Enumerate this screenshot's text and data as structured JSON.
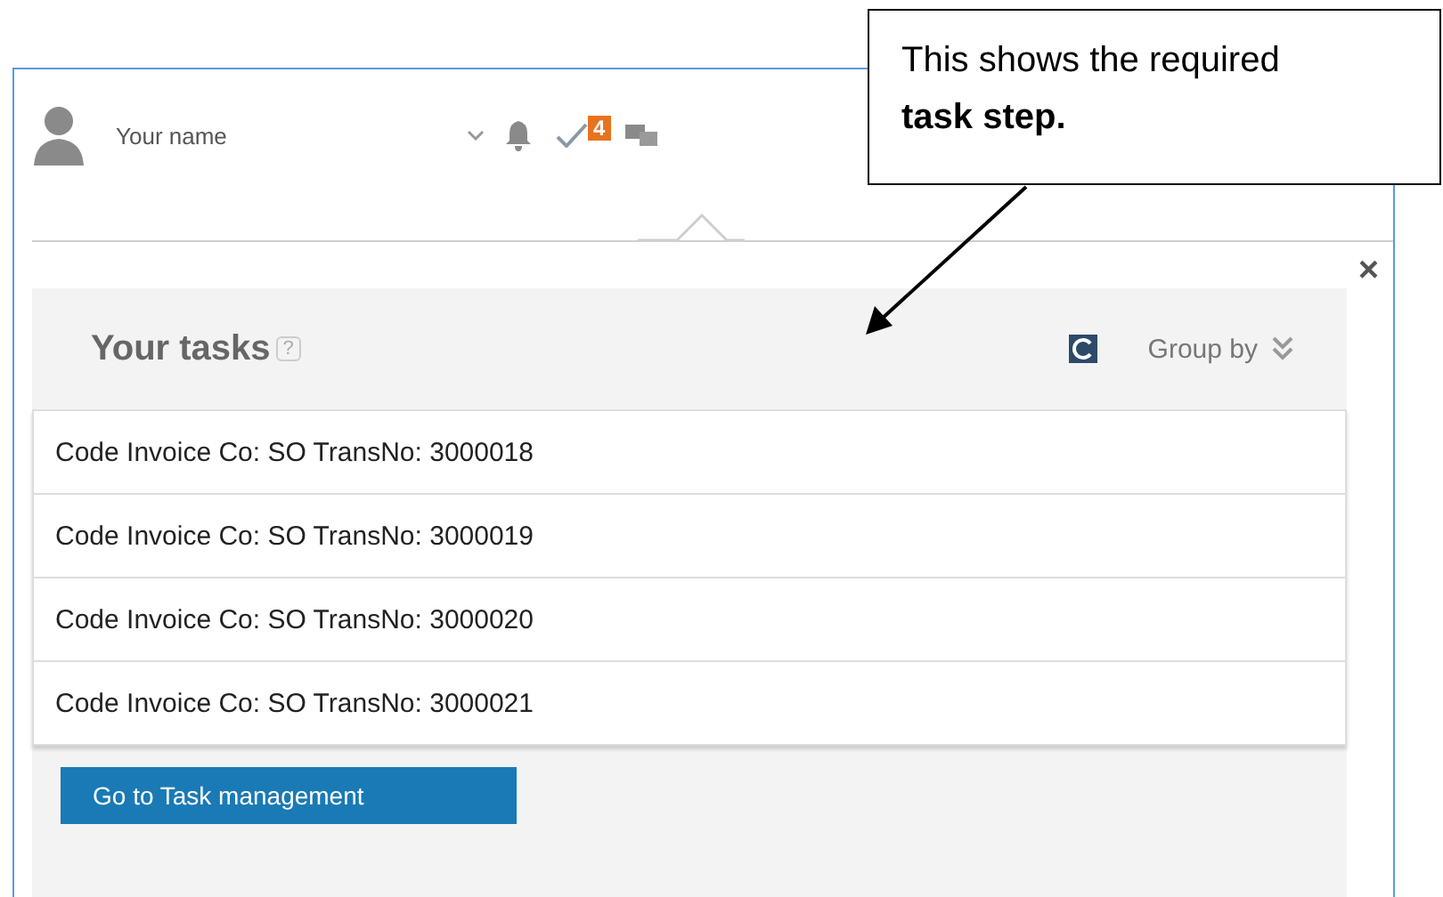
{
  "header": {
    "user_name": "Your name",
    "task_badge": "4"
  },
  "popup": {
    "close": "×",
    "title": "Your tasks",
    "help": "?",
    "group_by": "Group by",
    "tasks": [
      "Code Invoice Co: SO TransNo: 3000018",
      "Code Invoice Co: SO TransNo: 3000019",
      "Code Invoice Co: SO TransNo: 3000020",
      "Code Invoice Co: SO TransNo: 3000021"
    ],
    "button": "Go to Task management"
  },
  "callout": {
    "text": "This shows the required **task step.**"
  }
}
